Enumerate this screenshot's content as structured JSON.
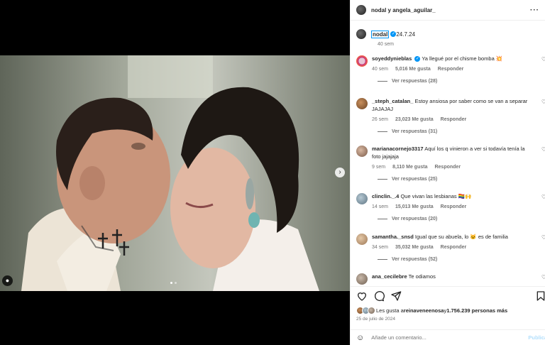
{
  "post": {
    "authors_title": "nodal y angela_aguilar_",
    "caption_user": "nodal",
    "caption_text": "24.7.24",
    "caption_time": "40 sem"
  },
  "comments": [
    {
      "user": "soyeddynieblas",
      "verified": true,
      "text": "Ya llegué por el chisme bomba 💥",
      "time": "40 sem",
      "likes": "5,016 Me gusta",
      "reply": "Responder",
      "replies": "Ver respuestas (28)"
    },
    {
      "user": "_steph_catalan_",
      "text": "Estoy ansiosa por saber como se van a separar JAJAJAJ",
      "time": "26 sem",
      "likes": "23,023 Me gusta",
      "reply": "Responder",
      "replies": "Ver respuestas (31)"
    },
    {
      "user": "marianacornejo3317",
      "text": "Aquí los q vinieron a ver si todavía tenía la foto jajajaja",
      "time": "9 sem",
      "likes": "8,110 Me gusta",
      "reply": "Responder",
      "replies": "Ver respuestas (25)"
    },
    {
      "user": "clinclin._.4",
      "text": "Que vivan las lesbianas 🏳️‍🌈🙌",
      "time": "14 sem",
      "likes": "15,013 Me gusta",
      "reply": "Responder",
      "replies": "Ver respuestas (20)"
    },
    {
      "user": "samantha._snsd",
      "text": "Igual que su abuela, lo 🐱 es de familia",
      "time": "34 sem",
      "likes": "35,032 Me gusta",
      "reply": "Responder",
      "replies": "Ver respuestas (52)"
    },
    {
      "user": "ana_cecilebre",
      "text": "Te odiamos"
    }
  ],
  "likes": {
    "prefix": "Les gusta a ",
    "user": "reinaveneenosa",
    "middle": " y ",
    "count": "1.756.239 personas más"
  },
  "date": "25 de julio de 2024",
  "add_comment": {
    "placeholder": "Añade un comentario...",
    "post_label": "Publicar"
  },
  "icons": {
    "more": "more-horizontal-icon",
    "next": "chevron-right-icon",
    "tag": "user-tag-icon",
    "heart": "heart-icon",
    "comment": "comment-icon",
    "share": "send-icon",
    "save": "bookmark-icon",
    "emoji": "emoji-icon"
  },
  "colors": {
    "accent": "#0095f6",
    "muted": "#737373"
  }
}
